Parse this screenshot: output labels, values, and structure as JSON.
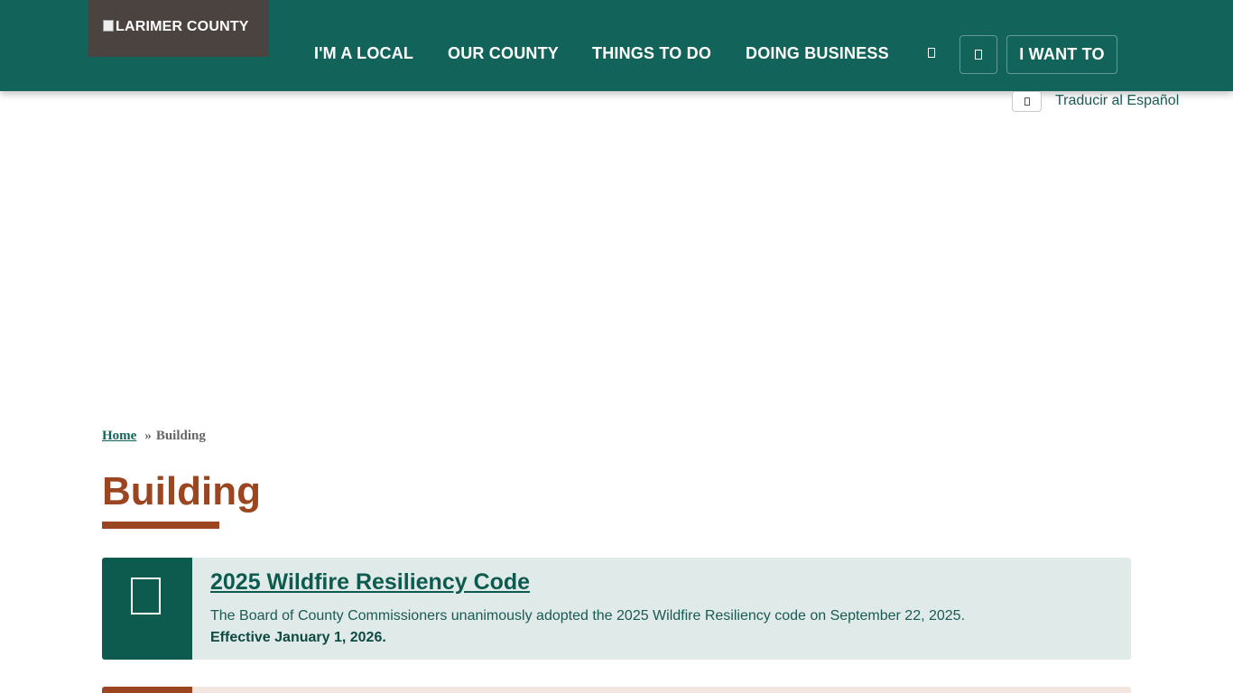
{
  "header": {
    "logo_alt": "LARIMER COUNTY",
    "nav": [
      {
        "label": "I'M A LOCAL"
      },
      {
        "label": "OUR COUNTY"
      },
      {
        "label": "THINGS TO DO"
      },
      {
        "label": "DOING BUSINESS"
      }
    ],
    "search_icon": "search-icon",
    "menu_icon": "menu-icon",
    "i_want_to_label": "I WANT TO"
  },
  "translate": {
    "icon": "globe-icon",
    "label": "Traducir al Español"
  },
  "breadcrumb": {
    "home_label": "Home",
    "separator": "»",
    "current": "Building"
  },
  "page": {
    "title": "Building"
  },
  "notice": {
    "icon": "document-icon",
    "title": "2025 Wildfire Resiliency Code",
    "text": "The Board of County Commissioners unanimously adopted the 2025 Wildfire Resiliency code on September 22, 2025.",
    "bold_text": "Effective January 1, 2026."
  },
  "colors": {
    "header_bg": "#12645a",
    "logo_bg": "#4a4340",
    "title_accent": "#9b4521",
    "notice_bg": "#e0eae8",
    "notice_icon_bg": "#0d5a4f"
  }
}
